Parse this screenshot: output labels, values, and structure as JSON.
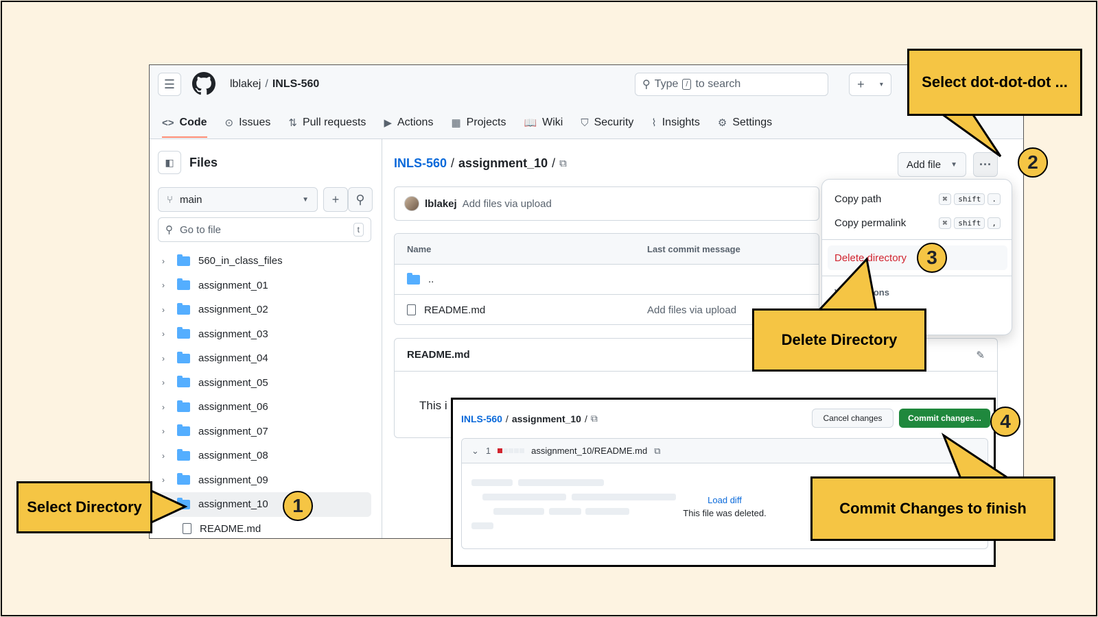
{
  "repo": {
    "owner": "lblakej",
    "separator": "/",
    "name": "INLS-560"
  },
  "search": {
    "prefix": "Type",
    "key": "/",
    "suffix": "to search"
  },
  "nav": {
    "tabs": [
      {
        "label": "Code",
        "icon": "code-icon",
        "glyph": "<>"
      },
      {
        "label": "Issues",
        "icon": "issue-icon",
        "glyph": "⊙"
      },
      {
        "label": "Pull requests",
        "icon": "pull-request-icon",
        "glyph": "⇅"
      },
      {
        "label": "Actions",
        "icon": "play-icon",
        "glyph": "▶"
      },
      {
        "label": "Projects",
        "icon": "table-icon",
        "glyph": "▦"
      },
      {
        "label": "Wiki",
        "icon": "book-icon",
        "glyph": "📖"
      },
      {
        "label": "Security",
        "icon": "shield-icon",
        "glyph": "⛉"
      },
      {
        "label": "Insights",
        "icon": "graph-icon",
        "glyph": "⌇"
      },
      {
        "label": "Settings",
        "icon": "gear-icon",
        "glyph": "⚙"
      }
    ]
  },
  "sidebar": {
    "title": "Files",
    "branch": "main",
    "goto_placeholder": "Go to file",
    "goto_key": "t",
    "items": [
      {
        "label": "560_in_class_files",
        "type": "folder"
      },
      {
        "label": "assignment_01",
        "type": "folder"
      },
      {
        "label": "assignment_02",
        "type": "folder"
      },
      {
        "label": "assignment_03",
        "type": "folder"
      },
      {
        "label": "assignment_04",
        "type": "folder"
      },
      {
        "label": "assignment_05",
        "type": "folder"
      },
      {
        "label": "assignment_06",
        "type": "folder"
      },
      {
        "label": "assignment_07",
        "type": "folder"
      },
      {
        "label": "assignment_08",
        "type": "folder"
      },
      {
        "label": "assignment_09",
        "type": "folder"
      },
      {
        "label": "assignment_10",
        "type": "folder",
        "selected": true
      },
      {
        "label": "README.md",
        "type": "file"
      }
    ]
  },
  "main": {
    "breadcrumb": {
      "repo": "INLS-560",
      "dir": "assignment_10"
    },
    "add_file": "Add file",
    "commit": {
      "author": "lblakej",
      "message": "Add files via upload"
    },
    "table": {
      "col_name": "Name",
      "col_message": "Last commit message",
      "rows": [
        {
          "name": "..",
          "message": ""
        },
        {
          "name": "README.md",
          "message": "Add files via upload"
        }
      ]
    },
    "readme": {
      "title": "README.md",
      "text": "This i"
    }
  },
  "menu": {
    "copy_path": "Copy path",
    "copy_path_keys": [
      "⌘",
      "shift",
      "."
    ],
    "copy_permalink": "Copy permalink",
    "copy_permalink_keys": [
      "⌘",
      "shift",
      ","
    ],
    "delete_directory": "Delete directory",
    "view_options": "View options"
  },
  "commit_panel": {
    "repo": "INLS-560",
    "dir": "assignment_10",
    "cancel": "Cancel changes",
    "commit": "Commit changes...",
    "diff_count": "1",
    "diff_file": "assignment_10/README.md",
    "load_diff": "Load diff",
    "deleted_msg": "This file was deleted."
  },
  "callouts": {
    "select_directory": "Select Directory",
    "select_dots": "Select dot-dot-dot ...",
    "delete_directory": "Delete Directory",
    "commit_changes": "Commit Changes to finish"
  },
  "steps": [
    "1",
    "2",
    "3",
    "4"
  ],
  "colors": {
    "callout": "#f5c544",
    "background": "#fdf3e1",
    "link": "#0969da",
    "danger": "#d1242f",
    "commit_green": "#1f883d",
    "folder": "#54aeff"
  }
}
